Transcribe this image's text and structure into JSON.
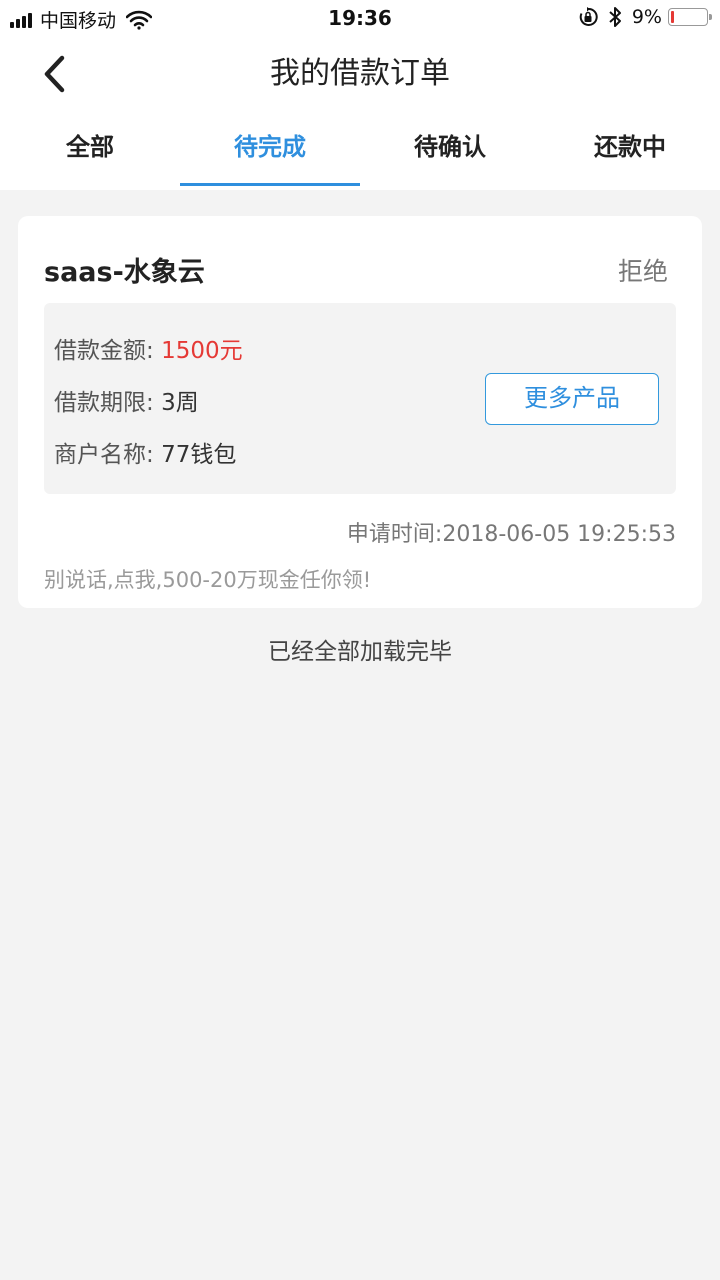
{
  "status_bar": {
    "carrier": "中国移动",
    "time": "19:36",
    "battery_percent": "9%",
    "battery_level": 0.09,
    "battery_color": "#e53935",
    "icons": [
      "signal-icon",
      "wifi-icon",
      "rotation-lock-icon",
      "bluetooth-icon",
      "battery-icon"
    ]
  },
  "nav": {
    "title": "我的借款订单",
    "back_icon": "chevron-left-icon"
  },
  "tabs": [
    {
      "label": "全部",
      "active": false
    },
    {
      "label": "待完成",
      "active": true
    },
    {
      "label": "待确认",
      "active": false
    },
    {
      "label": "还款中",
      "active": false
    }
  ],
  "order": {
    "name": "saas-水象云",
    "status": "拒绝",
    "amount_label": "借款金额:",
    "amount_value": "1500元",
    "term_label": "借款期限:",
    "term_value": "3周",
    "merchant_label": "商户名称:",
    "merchant_value": "77钱包",
    "more_button": "更多产品",
    "apply_time": "申请时间:2018-06-05 19:25:53",
    "promo": "别说话,点我,500-20万现金任你领!"
  },
  "footer": {
    "message": "已经全部加载完毕"
  },
  "colors": {
    "accent": "#2f8fde",
    "amount_red": "#e53935",
    "background": "#f3f3f3"
  }
}
